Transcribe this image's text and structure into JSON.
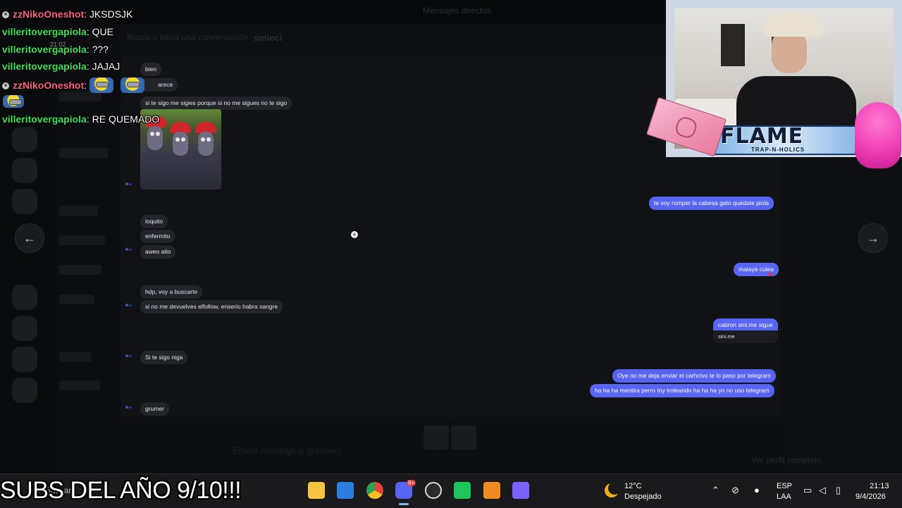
{
  "discord": {
    "topbar_title": "Mensajes directos",
    "header_search": "Busca o inicia una conversación",
    "header_user": "smieci",
    "composer_placeholder": "Enviar mensaje a @smieci",
    "profile_link": "Ver perfil completo"
  },
  "chat": {
    "incoming": [
      {
        "text": "bien"
      },
      {
        "text": "arece"
      },
      {
        "text": "si te sigo me sigies porque si no me sigues no te sigo"
      },
      {
        "text": "loquito"
      },
      {
        "text": "enfermito"
      },
      {
        "text": "aweo aito"
      },
      {
        "text": "hdp, voy a buscarte"
      },
      {
        "text": "si no me devuelves elfollow, enserio habra sangre"
      },
      {
        "text": "Si te sigo niga"
      },
      {
        "text": "grumer"
      }
    ],
    "outgoing": [
      {
        "text": "te voy  romper la cabesa gato quedate piola"
      },
      {
        "text": "malaya culea"
      },
      {
        "text": "cabron sini.me sigue"
      },
      {
        "text": "Oye no me deja enviar el carhcivo te lo paso por telegram"
      },
      {
        "text": "ha ha ha mentira perro toy troleando ha ha ha yo no uso telegram"
      }
    ],
    "embed_text": "sini.me",
    "reaction": "❤",
    "nav_prev": "←",
    "nav_next": "→"
  },
  "twitch_chat": [
    {
      "user": "zzNikoOneshot",
      "color": "pink",
      "badge": true,
      "message": ": JKSDSJK",
      "emotes": 0
    },
    {
      "user": "villeritovergapiola",
      "color": "green",
      "badge": false,
      "message": ": QUE",
      "emotes": 0
    },
    {
      "user": "villeritovergapiola",
      "color": "green",
      "badge": false,
      "message": ": ???",
      "emotes": 0
    },
    {
      "user": "villeritovergapiola",
      "color": "green",
      "badge": false,
      "message": ": JAJAJ",
      "emotes": 0
    },
    {
      "user": "zzNikoOneshot",
      "color": "pink",
      "badge": true,
      "message": ":",
      "emotes": 3
    },
    {
      "user": "villeritovergapiola",
      "color": "green",
      "badge": false,
      "message": ": RE QUEMADO",
      "emotes": 0
    }
  ],
  "twitch_timestamp": "21:02",
  "webcam": {
    "banner_title": "FLAME",
    "banner_sub": "TRAP-N-HOLICS"
  },
  "banner_text": "SUBS DEL AÑO 9/10!!!",
  "taskbar": {
    "search": "Buscar",
    "weather_temp": "12°C",
    "weather_desc": "Despejado",
    "lang_1": "ESP",
    "lang_2": "LAA",
    "time": "21:13",
    "date": "9/4/2026",
    "apps": [
      "file-explorer",
      "microsoft-store",
      "chrome",
      "discord",
      "obs",
      "capcut",
      "fl-studio",
      "app"
    ],
    "discord_badge": "9+"
  },
  "colors": {
    "outgoing_bubble": "#5865f2",
    "incoming_bubble": "#22242a",
    "twitch_pink": "#ff5f7e",
    "twitch_green": "#3ee25a"
  }
}
